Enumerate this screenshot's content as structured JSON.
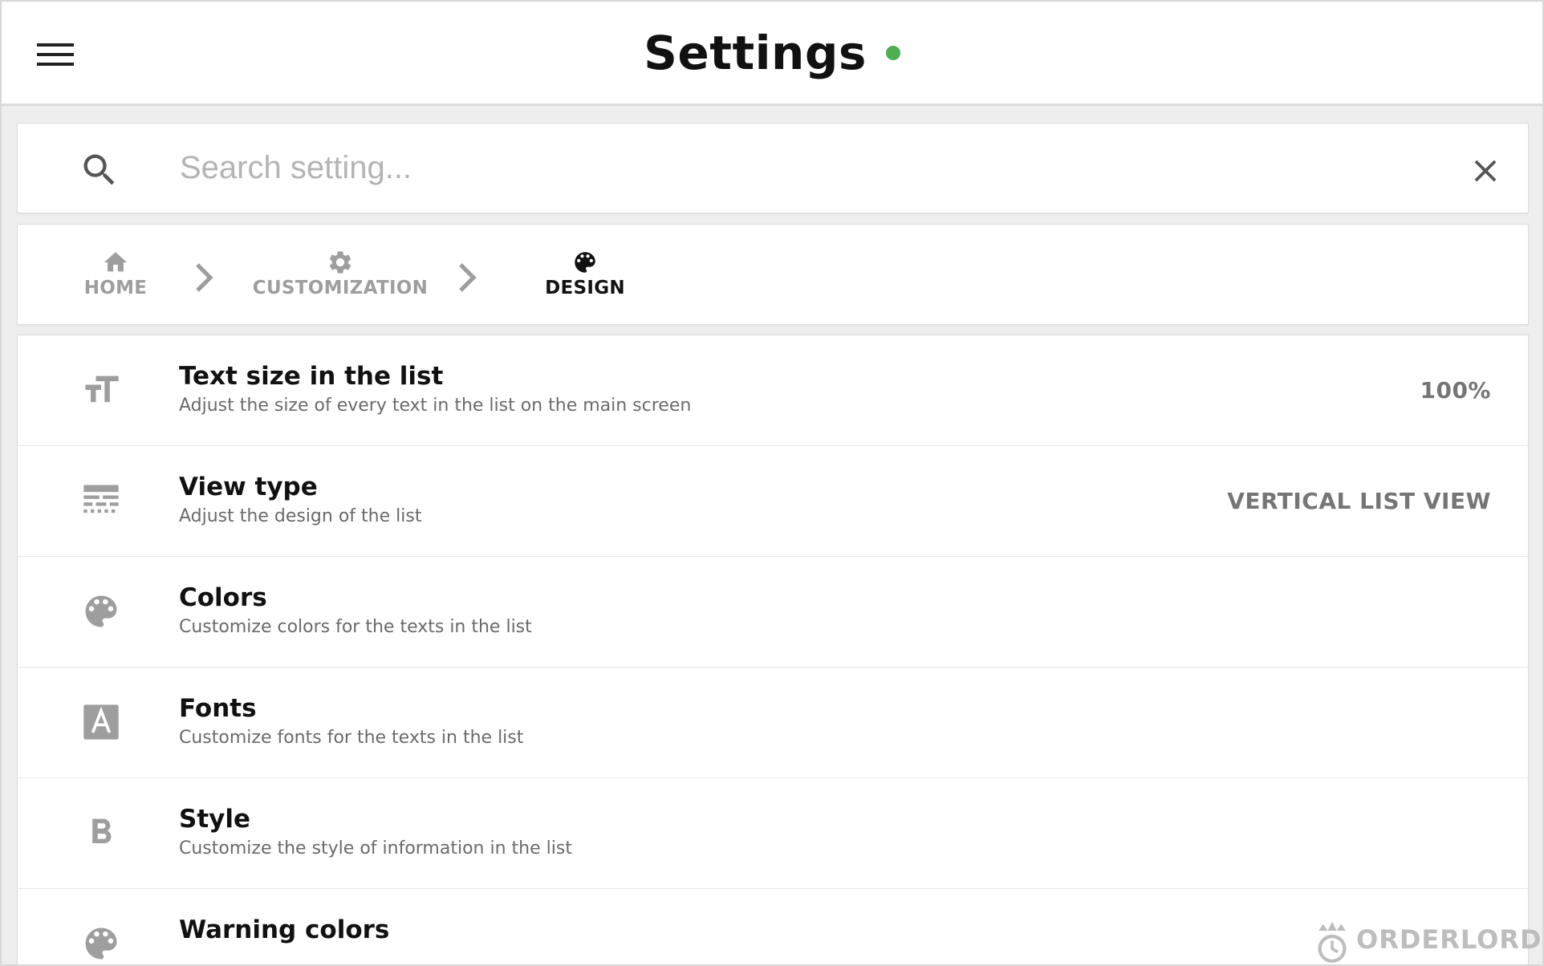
{
  "header": {
    "title": "Settings",
    "status_color": "#4caf50",
    "menu_icon": "menu-icon"
  },
  "search": {
    "placeholder": "Search setting...",
    "value": "",
    "search_icon": "search-icon",
    "clear_icon": "close-icon"
  },
  "breadcrumb": {
    "items": [
      {
        "label": "HOME",
        "icon": "home-icon",
        "active": false
      },
      {
        "label": "CUSTOMIZATION",
        "icon": "gear-icon",
        "active": false
      },
      {
        "label": "DESIGN",
        "icon": "palette-icon",
        "active": true
      }
    ],
    "inactive_color": "#9e9e9e",
    "active_color": "#111111"
  },
  "settings": [
    {
      "icon": "text-size-icon",
      "title": "Text size in the list",
      "description": "Adjust the size of every text in the list on the main screen",
      "value": "100%"
    },
    {
      "icon": "view-type-icon",
      "title": "View type",
      "description": "Adjust the design of the list",
      "value": "VERTICAL LIST VIEW"
    },
    {
      "icon": "palette-icon",
      "title": "Colors",
      "description": "Customize colors for the texts in the list",
      "value": ""
    },
    {
      "icon": "font-icon",
      "title": "Fonts",
      "description": "Customize fonts for the texts in the list",
      "value": ""
    },
    {
      "icon": "bold-icon",
      "title": "Style",
      "description": "Customize the style of information in the list",
      "value": ""
    },
    {
      "icon": "palette-icon",
      "title": "Warning colors",
      "description": "",
      "value": ""
    }
  ],
  "brand": {
    "name": "ORDERLORD",
    "icon": "orderlord-logo"
  },
  "colors": {
    "icon_gray": "#9e9e9e",
    "background": "#eeeeee"
  }
}
